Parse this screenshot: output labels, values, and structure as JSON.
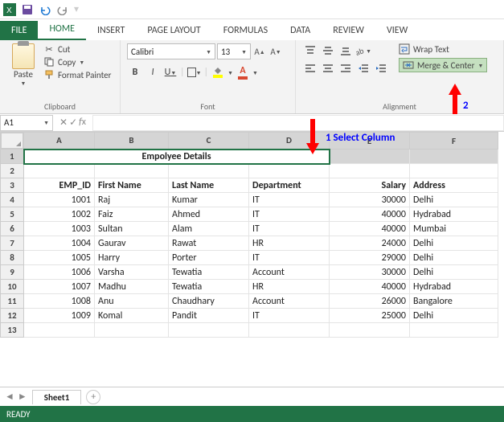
{
  "titlebar": {
    "app": "Excel"
  },
  "tabs": {
    "file": "FILE",
    "home": "HOME",
    "insert": "INSERT",
    "page_layout": "PAGE LAYOUT",
    "formulas": "FORMULAS",
    "data": "DATA",
    "review": "REVIEW",
    "view": "VIEW"
  },
  "clipboard": {
    "paste": "Paste",
    "cut": "Cut",
    "copy": "Copy",
    "format_painter": "Format Painter",
    "group": "Clipboard"
  },
  "font": {
    "name": "Calibri",
    "size": "13",
    "group": "Font",
    "bold": "B",
    "italic": "I",
    "under": "U",
    "color_A": "A"
  },
  "alignment": {
    "group": "Alignment",
    "wrap": "Wrap Text",
    "merge": "Merge & Center"
  },
  "namebox": "A1",
  "anno1": "1  Select Column",
  "anno2": "2",
  "columns": [
    "A",
    "B",
    "C",
    "D",
    "E",
    "F"
  ],
  "title_cell": "Empolyee Details",
  "headers": {
    "a": "EMP_ID",
    "b": "First Name",
    "c": "Last Name",
    "d": "Department",
    "e": "Salary",
    "f": "Address"
  },
  "rows": [
    {
      "a": "1001",
      "b": "Raj",
      "c": "Kumar",
      "d": "IT",
      "e": "30000",
      "f": "Delhi"
    },
    {
      "a": "1002",
      "b": "Faiz",
      "c": "Ahmed",
      "d": "IT",
      "e": "40000",
      "f": "Hydrabad"
    },
    {
      "a": "1003",
      "b": "Sultan",
      "c": "Alam",
      "d": "IT",
      "e": "40000",
      "f": "Mumbai"
    },
    {
      "a": "1004",
      "b": "Gaurav",
      "c": "Rawat",
      "d": "HR",
      "e": "24000",
      "f": "Delhi"
    },
    {
      "a": "1005",
      "b": "Harry",
      "c": "Porter",
      "d": "IT",
      "e": "29000",
      "f": "Delhi"
    },
    {
      "a": "1006",
      "b": "Varsha",
      "c": "Tewatia",
      "d": "Account",
      "e": "30000",
      "f": "Delhi"
    },
    {
      "a": "1007",
      "b": "Madhu",
      "c": "Tewatia",
      "d": "HR",
      "e": "40000",
      "f": "Hydrabad"
    },
    {
      "a": "1008",
      "b": "Anu",
      "c": "Chaudhary",
      "d": "Account",
      "e": "26000",
      "f": "Bangalore"
    },
    {
      "a": "1009",
      "b": "Komal",
      "c": "Pandit",
      "d": "IT",
      "e": "25000",
      "f": "Delhi"
    }
  ],
  "sheet": "Sheet1",
  "status": "READY"
}
